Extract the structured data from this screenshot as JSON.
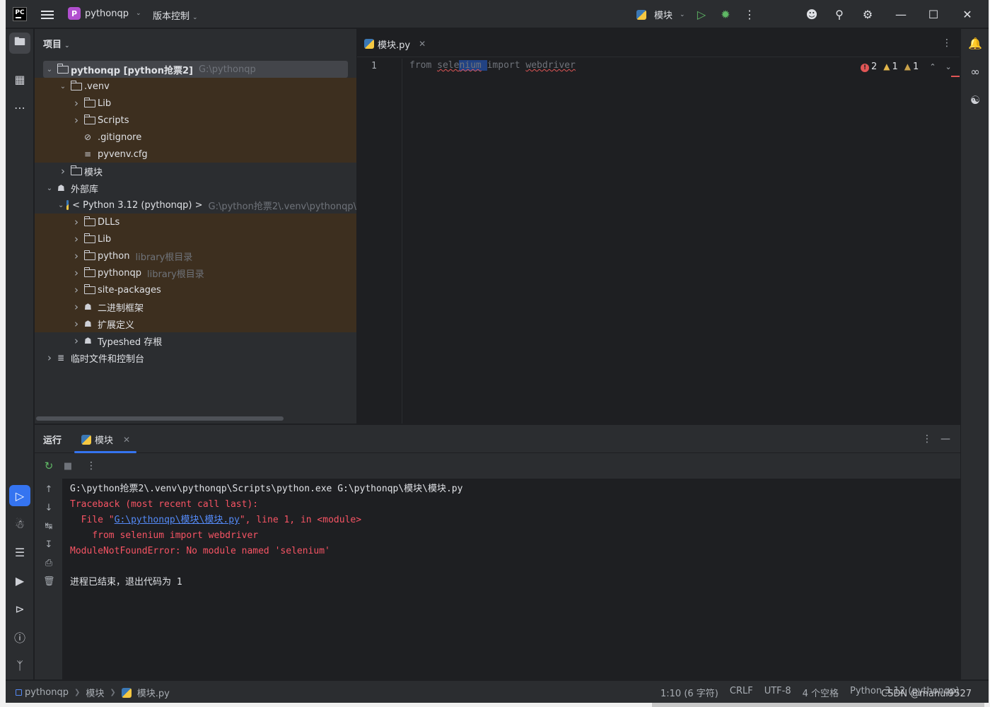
{
  "titlebar": {
    "logo": "PC",
    "project_badge": "P",
    "project_name": "pythonqp",
    "vcs": "版本控制",
    "run_config": "模块"
  },
  "project_panel": {
    "title": "项目",
    "tree": [
      {
        "label": "pythonqp [python抢票2]",
        "hint": "G:\\pythonqp",
        "type": "folder",
        "depth": 0,
        "expanded": true,
        "bold": true,
        "selected": true
      },
      {
        "label": ".venv",
        "type": "folder",
        "depth": 1,
        "expanded": true,
        "highlight": true
      },
      {
        "label": "Lib",
        "type": "folder",
        "depth": 2,
        "expanded": false,
        "highlight": true
      },
      {
        "label": "Scripts",
        "type": "folder",
        "depth": 2,
        "expanded": false,
        "highlight": true
      },
      {
        "label": ".gitignore",
        "type": "ignore",
        "depth": 2,
        "highlight": true
      },
      {
        "label": "pyvenv.cfg",
        "type": "config",
        "depth": 2,
        "highlight": true
      },
      {
        "label": "模块",
        "type": "folder",
        "depth": 1,
        "expanded": false
      },
      {
        "label": "外部库",
        "type": "library",
        "depth": 0,
        "expanded": true
      },
      {
        "label": "< Python 3.12 (pythonqp) >",
        "hint": "G:\\python抢票2\\.venv\\pythonqp\\",
        "type": "python",
        "depth": 1,
        "expanded": true
      },
      {
        "label": "DLLs",
        "type": "folder",
        "depth": 2,
        "expanded": false,
        "highlight": true
      },
      {
        "label": "Lib",
        "type": "folder",
        "depth": 2,
        "expanded": false,
        "highlight": true
      },
      {
        "label": "python",
        "hint": "library根目录",
        "type": "folder",
        "depth": 2,
        "expanded": false,
        "highlight": true
      },
      {
        "label": "pythonqp",
        "hint": "library根目录",
        "type": "folder",
        "depth": 2,
        "expanded": false,
        "highlight": true
      },
      {
        "label": "site-packages",
        "type": "folder",
        "depth": 2,
        "expanded": false,
        "highlight": true
      },
      {
        "label": "二进制框架",
        "type": "library",
        "depth": 2,
        "expanded": false,
        "highlight": true
      },
      {
        "label": "扩展定义",
        "type": "library",
        "depth": 2,
        "expanded": false,
        "highlight": true
      },
      {
        "label": "Typeshed 存根",
        "type": "library",
        "depth": 2,
        "expanded": false
      },
      {
        "label": "临时文件和控制台",
        "type": "scratch",
        "depth": 0,
        "expanded": false
      }
    ]
  },
  "editor": {
    "tab_name": "模块.py",
    "line_number": "1",
    "code": {
      "kw_from": "from",
      "mod_a": "sele",
      "mod_b": "nium",
      "kw_import": "import",
      "name": "webdriver"
    },
    "inspections": {
      "errors": "2",
      "warnings": "1",
      "weak_warnings": "1"
    }
  },
  "run_panel": {
    "title": "运行",
    "tab_name": "模块",
    "console": {
      "command": "G:\\python抢票2\\.venv\\pythonqp\\Scripts\\python.exe G:\\pythonqp\\模块\\模块.py",
      "traceback": "Traceback (most recent call last):",
      "file_prefix": "  File \"",
      "file_link": "G:\\pythonqp\\模块\\模块.py",
      "file_suffix": "\", line 1, in <module>",
      "code_line": "    from selenium import webdriver",
      "error": "ModuleNotFoundError: No module named 'selenium'",
      "exit": "进程已结束，退出代码为 1"
    }
  },
  "statusbar": {
    "crumbs": [
      "pythonqp",
      "模块",
      "模块.py"
    ],
    "position": "1:10 (6 字符)",
    "line_sep": "CRLF",
    "encoding": "UTF-8",
    "indent": "4 个空格",
    "interpreter": "Python 3.12 (pythonqp)"
  },
  "watermark": "CSDN @mahui9527",
  "colors": {
    "bg": "#1e1f22",
    "panel": "#2b2d30",
    "accent": "#3574f0",
    "error": "#f75464",
    "link": "#548af7",
    "excluded_highlight": "#3d2f1f"
  }
}
